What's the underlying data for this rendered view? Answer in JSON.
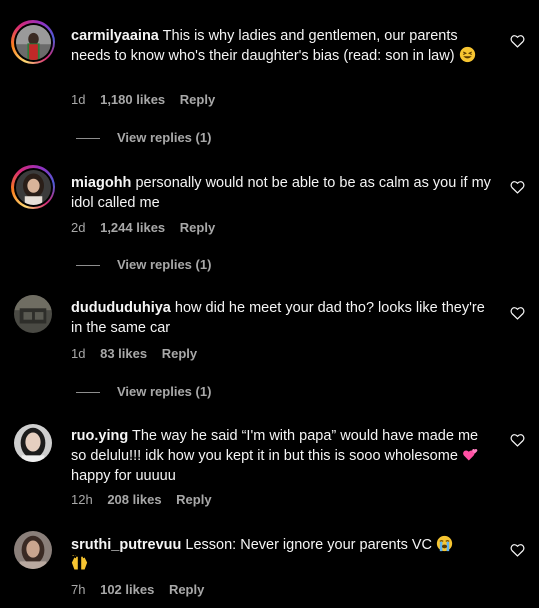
{
  "comments": [
    {
      "username": "carmilyaaina",
      "text": "This is why ladies and gentlemen, our parents needs to know who's their daughter's bias (read: son in law)",
      "emoji": "grinning-squint-emoji",
      "time": "1d",
      "likes": "1,180 likes",
      "reply": "Reply",
      "view_replies": "View replies (1)"
    },
    {
      "username": "miagohh",
      "text": "personally would not be able to be as calm as you if my idol called me",
      "time": "2d",
      "likes": "1,244 likes",
      "reply": "Reply",
      "view_replies": "View replies (1)"
    },
    {
      "username": "dudududuhiya",
      "text": "how did he meet your dad tho? looks like they're in the same car",
      "time": "1d",
      "likes": "83 likes",
      "reply": "Reply",
      "view_replies": "View replies (1)"
    },
    {
      "username": "ruo.ying",
      "text_part1": "The way he said “I'm with papa” would have made me so delulu!!! idk how you kept it in but this is sooo wholesome",
      "emoji": "two-hearts-emoji",
      "text_part2": "happy for uuuuu",
      "time": "12h",
      "likes": "208 likes",
      "reply": "Reply"
    },
    {
      "username": "sruthi_putrevuu",
      "text": "Lesson: Never ignore your parents VC",
      "emoji1": "loudly-crying-emoji",
      "emoji2": "raising-hands-emoji",
      "time": "7h",
      "likes": "102 likes",
      "reply": "Reply"
    }
  ],
  "colors": {
    "background": "#000000",
    "text": "#f5f5f5",
    "secondary": "#a8a8a8"
  },
  "icons": {
    "like": "heart-outline-icon"
  }
}
